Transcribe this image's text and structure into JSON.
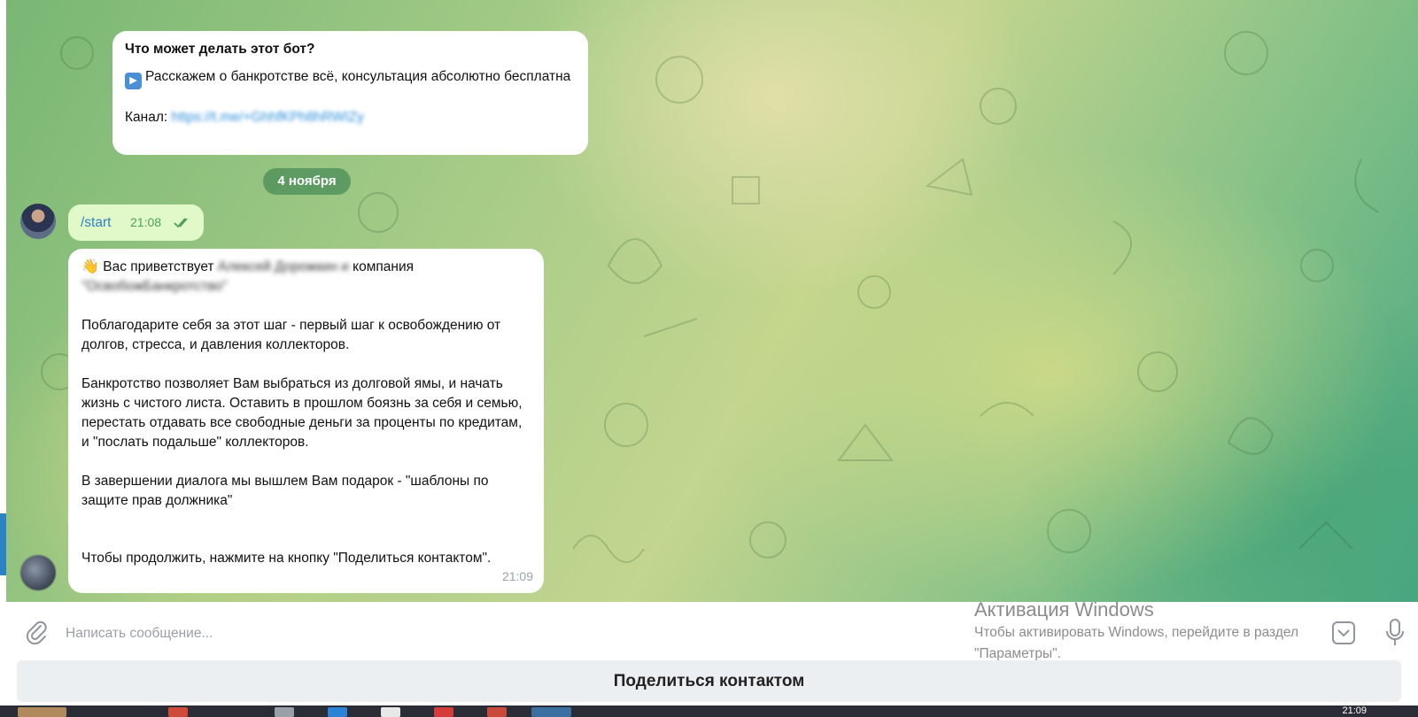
{
  "bot_info": {
    "title": "Что может делать этот бот?",
    "description": "Расскажем о банкротстве всё, консультация абсолютно бесплатна",
    "channel_label": "Канал:",
    "channel_link": "https://t.me/+GhhfKPh8hRWIZy"
  },
  "date_separator": "4 ноября",
  "outgoing_message": {
    "text": "/start",
    "time": "21:08"
  },
  "bot_message": {
    "greeting_start": "Вас приветствует",
    "greeting_name_blurred": "Алексей Дорожкин и",
    "greeting_end": "компания",
    "company_blurred": "\"ОсвобожБанкротство\"",
    "paragraph_1": "Поблагодарите себя за этот шаг - первый шаг к освобождению от долгов, стресса, и давления коллекторов.",
    "paragraph_2": "Банкротство позволяет Вам выбраться из долговой ямы, и начать жизнь с чистого листа. Оставить в прошлом боязнь за себя и семью, перестать отдавать все свободные деньги за проценты по кредитам, и \"послать подальше\" коллекторов.",
    "paragraph_3": "В завершении диалога мы вышлем Вам подарок - \"шаблоны по защите прав должника\"",
    "paragraph_4": "Чтобы продолжить, нажмите на кнопку \"Поделиться контактом\".",
    "time": "21:09"
  },
  "composer": {
    "placeholder": "Написать сообщение..."
  },
  "watermark": {
    "title": "Активация Windows",
    "line_1": "Чтобы активировать Windows, перейдите в раздел",
    "line_2": "\"Параметры\"."
  },
  "keyboard": {
    "share_contact_label": "Поделиться контактом"
  },
  "taskbar": {
    "clock": "21:09"
  },
  "icons": {
    "attach": "paperclip-icon",
    "sticker": "sticker-icon",
    "mic": "microphone-icon",
    "read": "double-check-icon",
    "play": "play-button-emoji",
    "wave": "waving-hand-emoji"
  },
  "colors": {
    "outgoing_bubble": "#e1f9c9",
    "link": "#2b8fd9",
    "time_outgoing": "#4fa152",
    "share_button_bg": "#eceff1"
  }
}
